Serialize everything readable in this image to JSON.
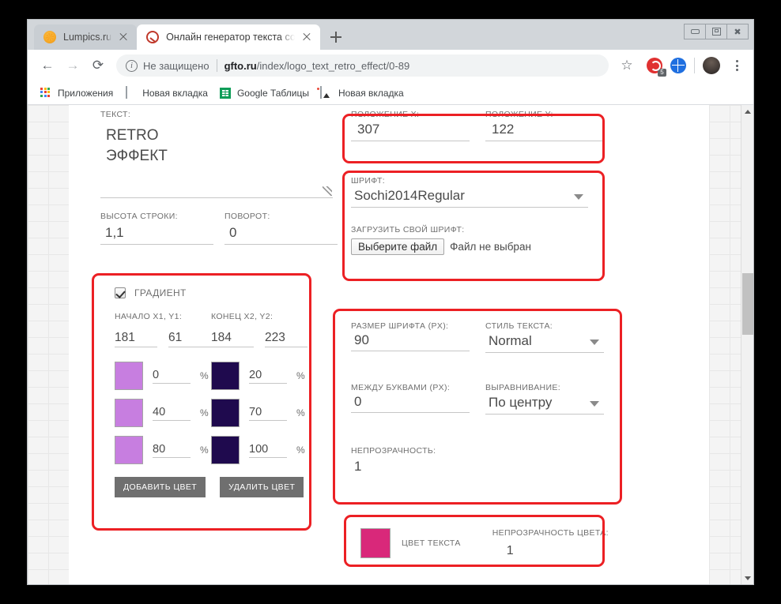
{
  "browser": {
    "tabs": [
      {
        "title": "Lumpics.ru",
        "icon": "orange-favicon",
        "active": false
      },
      {
        "title": "Онлайн генератор текста созда",
        "icon": "target-favicon",
        "active": true
      }
    ],
    "new_tab_label": "+",
    "window_controls": {
      "minimize": "minimize-icon",
      "maximize": "maximize-icon",
      "close": "close-icon"
    },
    "nav": {
      "back": "←",
      "forward": "→",
      "reload": "⟳"
    },
    "omnibox": {
      "security_label": "Не защищено",
      "url_host": "gfto.ru",
      "url_path": "/index/logo_text_retro_effect/0-89",
      "star": "☆"
    },
    "toolbar_icons": [
      "adblock-icon",
      "translate-globe-icon",
      "avatar-icon",
      "kebab-menu-icon"
    ],
    "adblock_badge": "5",
    "bookmarks": [
      {
        "label": "Приложения",
        "icon": "apps-grid-icon"
      },
      {
        "label": "Новая вкладка",
        "icon": "page-icon"
      },
      {
        "label": "Google Таблицы",
        "icon": "google-sheets-icon"
      },
      {
        "label": "Новая вкладка",
        "icon": "photo-icon"
      }
    ]
  },
  "form": {
    "text": {
      "label": "ТЕКСТ:",
      "lines": [
        "RETRO",
        "ЭФФЕКТ"
      ]
    },
    "line_height": {
      "label": "ВЫСОТА СТРОКИ:",
      "value": "1,1"
    },
    "rotation": {
      "label": "ПОВОРОТ:",
      "value": "0"
    },
    "gradient": {
      "checkbox_label": "ГРАДИЕНТ",
      "checked": true,
      "start_label": "НАЧАЛО X1, Y1:",
      "end_label": "КОНЕЦ X2, Y2:",
      "start": {
        "x": "181",
        "y": "61"
      },
      "end": {
        "x": "184",
        "y": "223"
      },
      "unit": "%",
      "stops_left": [
        {
          "color": "#c77ee0",
          "percent": "0"
        },
        {
          "color": "#c77ee0",
          "percent": "40"
        },
        {
          "color": "#c77ee0",
          "percent": "80"
        }
      ],
      "stops_right": [
        {
          "color": "#1f0a4e",
          "percent": "20"
        },
        {
          "color": "#1f0a4e",
          "percent": "70"
        },
        {
          "color": "#1f0a4e",
          "percent": "100"
        }
      ],
      "add_button": "ДОБАВИТЬ ЦВЕТ",
      "remove_button": "УДАЛИТЬ ЦВЕТ"
    },
    "position_x": {
      "label": "ПОЛОЖЕНИЕ X:",
      "value": "307"
    },
    "position_y": {
      "label": "ПОЛОЖЕНИЕ Y:",
      "value": "122"
    },
    "font": {
      "label": "ШРИФТ:",
      "value": "Sochi2014Regular",
      "upload_label": "ЗАГРУЗИТЬ СВОЙ ШРИФТ:",
      "file_button": "Выберите файл",
      "file_status": "Файл не выбран"
    },
    "font_size": {
      "label": "РАЗМЕР ШРИФТА (PX):",
      "value": "90"
    },
    "text_style": {
      "label": "СТИЛЬ ТЕКСТА:",
      "value": "Normal"
    },
    "letter_spacing": {
      "label": "МЕЖДУ БУКВАМИ (PX):",
      "value": "0"
    },
    "alignment": {
      "label": "ВЫРАВНИВАНИЕ:",
      "value": "По центру"
    },
    "opacity": {
      "label": "НЕПРОЗРАЧНОСТЬ:",
      "value": "1"
    },
    "text_color": {
      "swatch_color": "#d9287a",
      "label": "ЦВЕТ ТЕКСТА",
      "opacity_label": "НЕПРОЗРАЧНОСТЬ ЦВЕТА:",
      "opacity_value": "1"
    }
  },
  "annotations": {
    "color": "#ec2024",
    "boxes": [
      "position-xy",
      "font-block",
      "gradient-block",
      "font-size-block",
      "text-color-block"
    ]
  }
}
